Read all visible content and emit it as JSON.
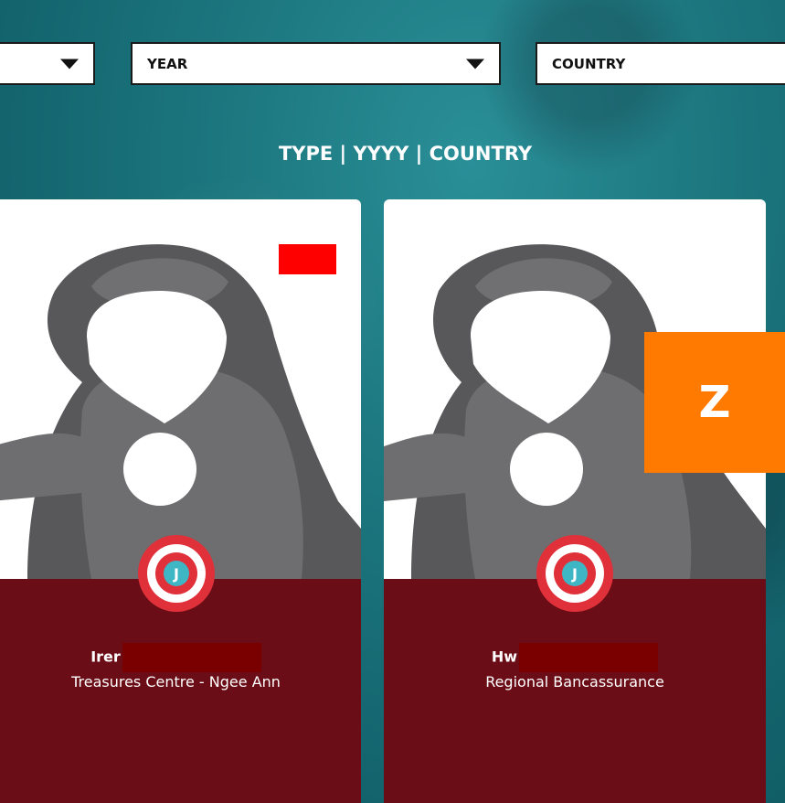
{
  "filters": {
    "type": {
      "label": ""
    },
    "year": {
      "label": "YEAR"
    },
    "country": {
      "label": "COUNTRY"
    }
  },
  "subtitle": "TYPE | YYYY | COUNTRY",
  "cards": [
    {
      "name": "Irer",
      "department": "Treasures Centre - Ngee Ann",
      "badge_letter": "J"
    },
    {
      "name": "Hw",
      "department": "Regional Bancassurance",
      "badge_letter": "J"
    }
  ],
  "overlay": {
    "label": "Z",
    "color": "#ff7a00"
  },
  "colors": {
    "background": "#1d7880",
    "card_info": "#6b0d16",
    "silhouette": "#6e6e70",
    "badge_red": "#e0303a",
    "badge_teal": "#3fb6c4",
    "redaction": "#7a0000",
    "red_tag": "#ff0000"
  }
}
